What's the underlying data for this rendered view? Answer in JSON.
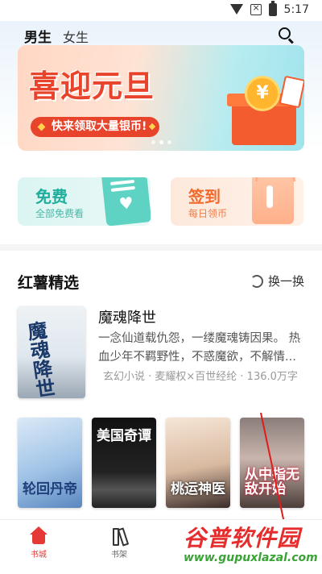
{
  "status_bar": {
    "time": "5:17"
  },
  "header": {
    "tabs": [
      {
        "label": "男生",
        "active": true
      },
      {
        "label": "女生",
        "active": false
      }
    ]
  },
  "banner": {
    "title": "喜迎元旦",
    "subtitle": "快来领取大量银币!",
    "coin_symbol": "¥",
    "dots": 3,
    "active_dot": 1
  },
  "quick_cards": {
    "free": {
      "title": "免费",
      "sub": "全部免费看"
    },
    "signin": {
      "title": "签到",
      "sub": "每日领币"
    }
  },
  "section": {
    "title": "红薯精选",
    "refresh_label": "换一换"
  },
  "featured_book": {
    "title": "魔魂降世",
    "cover_text": "魔魂降世",
    "description": "一念仙道载仇怨，一缕魔魂铸因果。 热血少年不羁野性，不惑魔欲，不解情...",
    "meta": "玄幻小说 · 麦耀权×百世经纶 · 136.0万字"
  },
  "book_covers": [
    {
      "title": "轮回丹帝"
    },
    {
      "title": "美国奇谭"
    },
    {
      "title": "桃运神医"
    },
    {
      "title": "从中指无敌开始"
    }
  ],
  "tabbar": {
    "home_label": "书城",
    "shelf_label": "书架"
  },
  "watermark": {
    "cn": "谷普软件园",
    "en": "www.gupuxlazal.com"
  },
  "colors": {
    "accent": "#e53935",
    "teal": "#1fae9c",
    "orange": "#f06a2b"
  }
}
